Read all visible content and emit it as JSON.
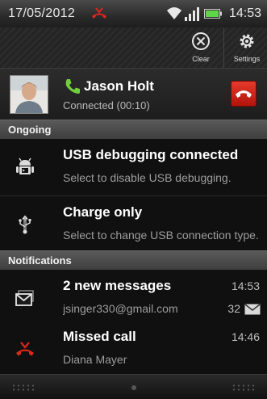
{
  "status_bar": {
    "date": "17/05/2012",
    "time": "14:53",
    "icons": [
      "missed-call-icon",
      "wifi-icon",
      "signal-icon",
      "battery-icon"
    ]
  },
  "action_bar": {
    "clear_label": "Clear",
    "settings_label": "Settings"
  },
  "call": {
    "name": "Jason Holt",
    "status": "Connected (00:10)"
  },
  "sections": {
    "ongoing": "Ongoing",
    "notifications": "Notifications"
  },
  "ongoing": [
    {
      "title": "USB debugging connected",
      "subtitle": "Select to disable USB debugging.",
      "icon": "android-debug-icon"
    },
    {
      "title": "Charge only",
      "subtitle": "Select to change USB connection type.",
      "icon": "usb-icon"
    }
  ],
  "notifications": [
    {
      "title": "2 new messages",
      "subtitle": "jsinger330@gmail.com",
      "time": "14:53",
      "count": "32",
      "icon": "gmail-icon"
    },
    {
      "title": "Missed call",
      "subtitle": "Diana Mayer",
      "time": "14:46",
      "icon": "missed-call-icon"
    }
  ],
  "colors": {
    "call_green": "#6fcf3a",
    "end_call_red": "#d2251a",
    "missed_red": "#e0261b"
  }
}
